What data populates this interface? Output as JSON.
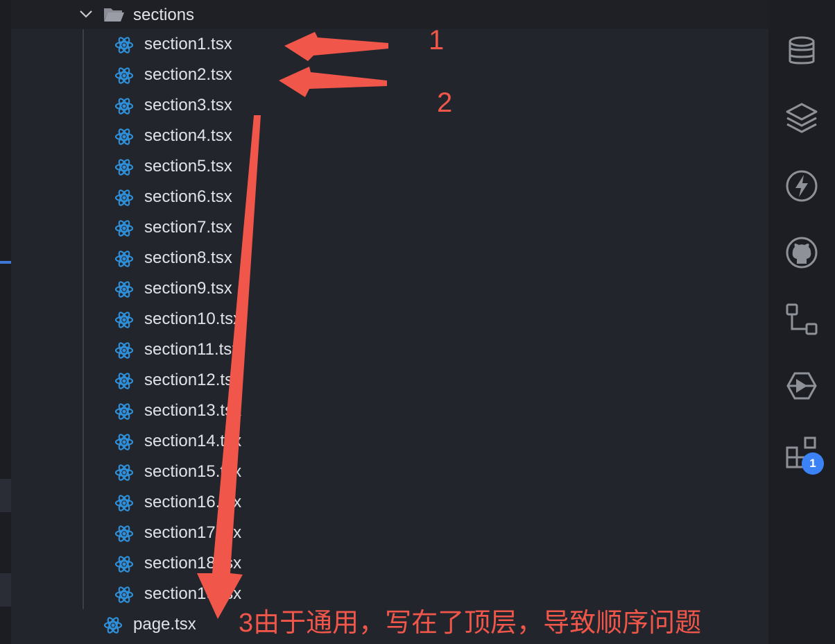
{
  "explorer": {
    "folder": {
      "label": "sections",
      "expanded": true
    },
    "files": [
      {
        "label": "section1.tsx"
      },
      {
        "label": "section2.tsx"
      },
      {
        "label": "section3.tsx"
      },
      {
        "label": "section4.tsx"
      },
      {
        "label": "section5.tsx"
      },
      {
        "label": "section6.tsx"
      },
      {
        "label": "section7.tsx"
      },
      {
        "label": "section8.tsx"
      },
      {
        "label": "section9.tsx"
      },
      {
        "label": "section10.tsx"
      },
      {
        "label": "section11.tsx"
      },
      {
        "label": "section12.tsx"
      },
      {
        "label": "section13.tsx"
      },
      {
        "label": "section14.tsx"
      },
      {
        "label": "section15.tsx"
      },
      {
        "label": "section16.tsx"
      },
      {
        "label": "section17.tsx"
      },
      {
        "label": "section18.tsx"
      },
      {
        "label": "section19.tsx"
      }
    ],
    "root_file": {
      "label": "page.tsx"
    },
    "file_icon": "react-icon",
    "folder_icon": "folder-open-icon"
  },
  "activity_bar": {
    "items": [
      {
        "icon": "database-icon"
      },
      {
        "icon": "layers-icon"
      },
      {
        "icon": "lightning-icon"
      },
      {
        "icon": "github-icon"
      },
      {
        "icon": "flow-icon"
      },
      {
        "icon": "brand-icon"
      },
      {
        "icon": "extensions-icon"
      }
    ],
    "badge_count": "1"
  },
  "annotations": {
    "numbers": [
      "1",
      "2"
    ],
    "note": "3由于通用，写在了顶层，导致顺序问题",
    "color": "#f0564a"
  },
  "colors": {
    "explorer_bg": "#22252c",
    "react_icon": "#2f8fd8",
    "badge": "#3b82f6",
    "accent_mark": "#3f78d6"
  }
}
